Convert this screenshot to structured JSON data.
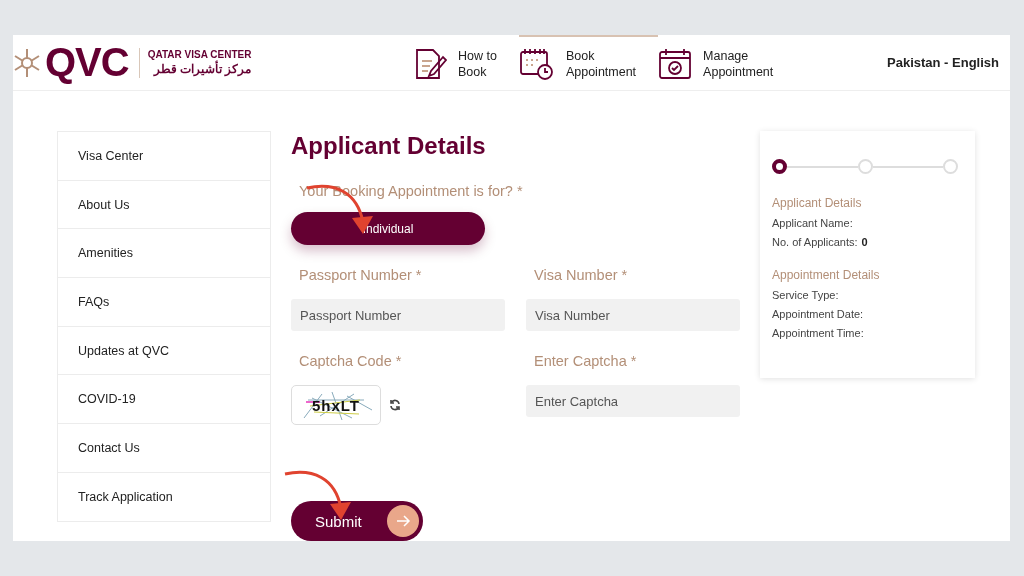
{
  "header": {
    "logo": {
      "wordmark": "QVC",
      "name_en": "QATAR VISA CENTER",
      "name_ar": "مركز تأشيرات قطر"
    },
    "nav": [
      {
        "kind": "document",
        "lines": [
          "How to",
          "Book"
        ],
        "selected": false
      },
      {
        "kind": "calendar-clock",
        "lines": [
          "Book",
          "Appointment"
        ],
        "selected": true
      },
      {
        "kind": "calendar-check",
        "lines": [
          "Manage",
          "Appointment"
        ],
        "selected": false
      }
    ],
    "locale": "Pakistan - English"
  },
  "sidebar": {
    "items": [
      "Visa Center",
      "About Us",
      "Amenities",
      "FAQs",
      "Updates at QVC",
      "COVID-19",
      "Contact Us",
      "Track Application"
    ]
  },
  "form": {
    "title": "Applicant Details",
    "question": "Your Booking Appointment is for? *",
    "options": [
      {
        "label": "Individual",
        "selected": true
      }
    ],
    "fields": [
      {
        "label": "Passport Number *",
        "placeholder": "Passport Number"
      },
      {
        "label": "Visa Number *",
        "placeholder": "Visa Number"
      }
    ],
    "captcha": {
      "label": "Captcha Code *",
      "code": "5hxLT"
    },
    "captcha_field": {
      "label": "Enter Captcha *",
      "placeholder": "Enter Captcha"
    },
    "submit": "Submit"
  },
  "summary": {
    "steps": [
      {
        "selected": true
      },
      {
        "selected": false
      },
      {
        "selected": false
      }
    ],
    "sections": [
      {
        "heading": "Applicant Details",
        "rows": [
          {
            "label": "Applicant Name:"
          },
          {
            "label": "No. of Applicants:",
            "value": "0"
          }
        ]
      },
      {
        "heading": "Appointment Details",
        "rows": [
          {
            "label": "Service Type:"
          },
          {
            "label": "Appointment Date:"
          },
          {
            "label": "Appointment Time:"
          }
        ]
      }
    ]
  }
}
